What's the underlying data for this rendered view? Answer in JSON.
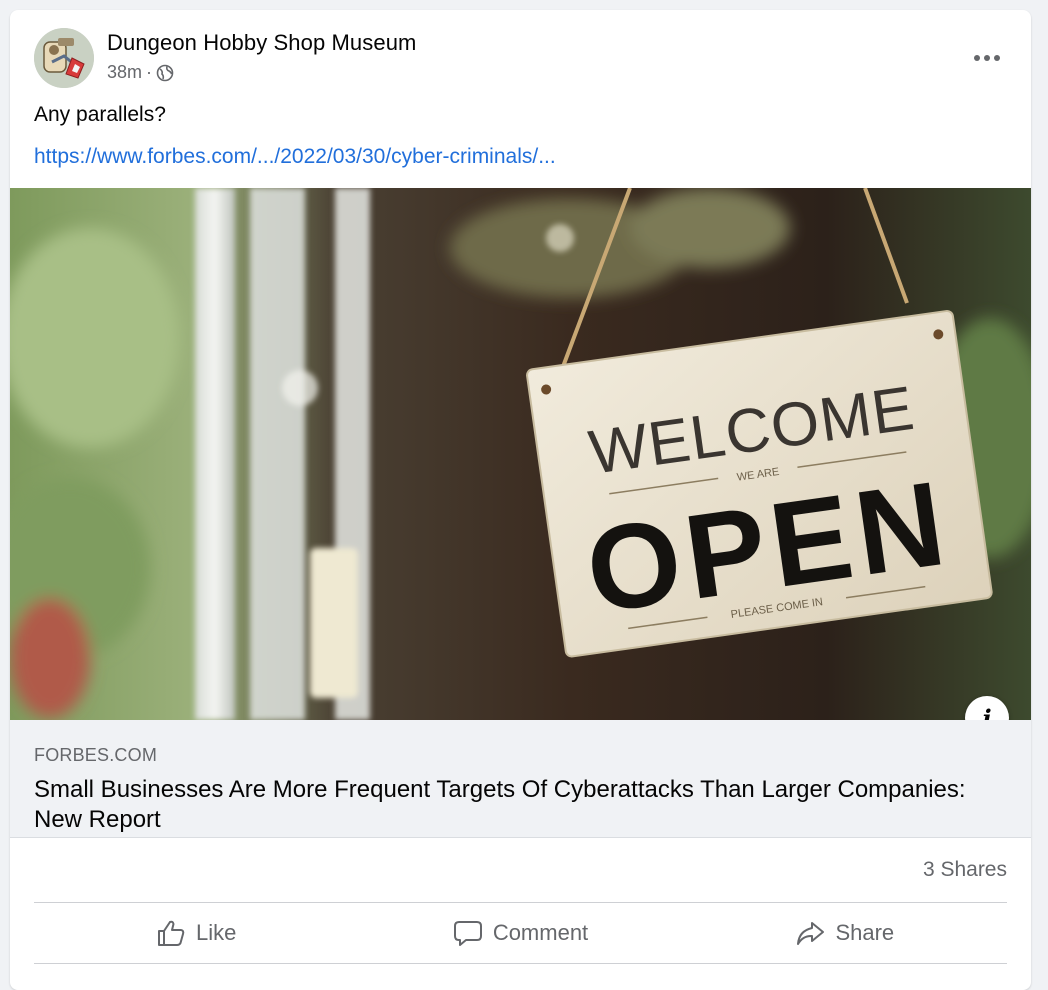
{
  "post": {
    "author": "Dungeon Hobby Shop Museum",
    "time": "38m",
    "separator": "·",
    "privacy_icon": "globe-icon",
    "text": "Any parallels?",
    "link_text": "https://www.forbes.com/.../2022/03/30/cyber-criminals/...",
    "more_icon": "more-horizontal-icon"
  },
  "image": {
    "sign_line1": "WELCOME",
    "sign_small1": "WE ARE",
    "sign_line2": "OPEN",
    "sign_small2": "PLEASE COME IN"
  },
  "preview": {
    "domain": "FORBES.COM",
    "title": "Small Businesses Are More Frequent Targets Of Cyberattacks Than Larger Companies: New Report",
    "info_label": "i"
  },
  "stats": {
    "shares": "3 Shares"
  },
  "actions": [
    {
      "label": "Like",
      "icon": "thumbs-up-icon"
    },
    {
      "label": "Comment",
      "icon": "comment-icon"
    },
    {
      "label": "Share",
      "icon": "share-arrow-icon"
    }
  ],
  "colors": {
    "link": "#216fdb",
    "secondary_text": "#65676b",
    "primary_text": "#050505",
    "preview_bg": "#f0f2f5"
  }
}
